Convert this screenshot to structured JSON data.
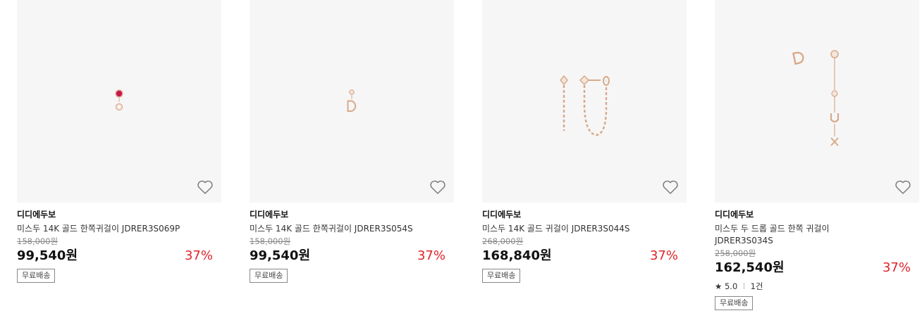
{
  "products": [
    {
      "brand": "디디에두보",
      "name": "미스두 14K 골드 한쪽귀걸이 JDRER3S069P",
      "original_price": "158,000원",
      "price": "99,540원",
      "discount": "37%",
      "badge": "무료배송"
    },
    {
      "brand": "디디에두보",
      "name": "미스두 14K 골드 한쪽귀걸이 JDRER3S054S",
      "original_price": "158,000원",
      "price": "99,540원",
      "discount": "37%",
      "badge": "무료배송"
    },
    {
      "brand": "디디에두보",
      "name": "미스두 14K 골드 귀걸이 JDRER3S044S",
      "original_price": "268,000원",
      "price": "168,840원",
      "discount": "37%",
      "badge": "무료배송"
    },
    {
      "brand": "디디에두보",
      "name": "미스두 두 드롭 골드 한쪽 귀걸이 JDRER3S034S",
      "original_price": "258,000원",
      "price": "162,540원",
      "discount": "37%",
      "rating": "5.0",
      "reviews": "1건",
      "badge": "무료배송"
    }
  ],
  "colors": {
    "discount": "#e0242b",
    "thumb_bg": "#f6f6f6",
    "gold": "#d9a98a"
  }
}
